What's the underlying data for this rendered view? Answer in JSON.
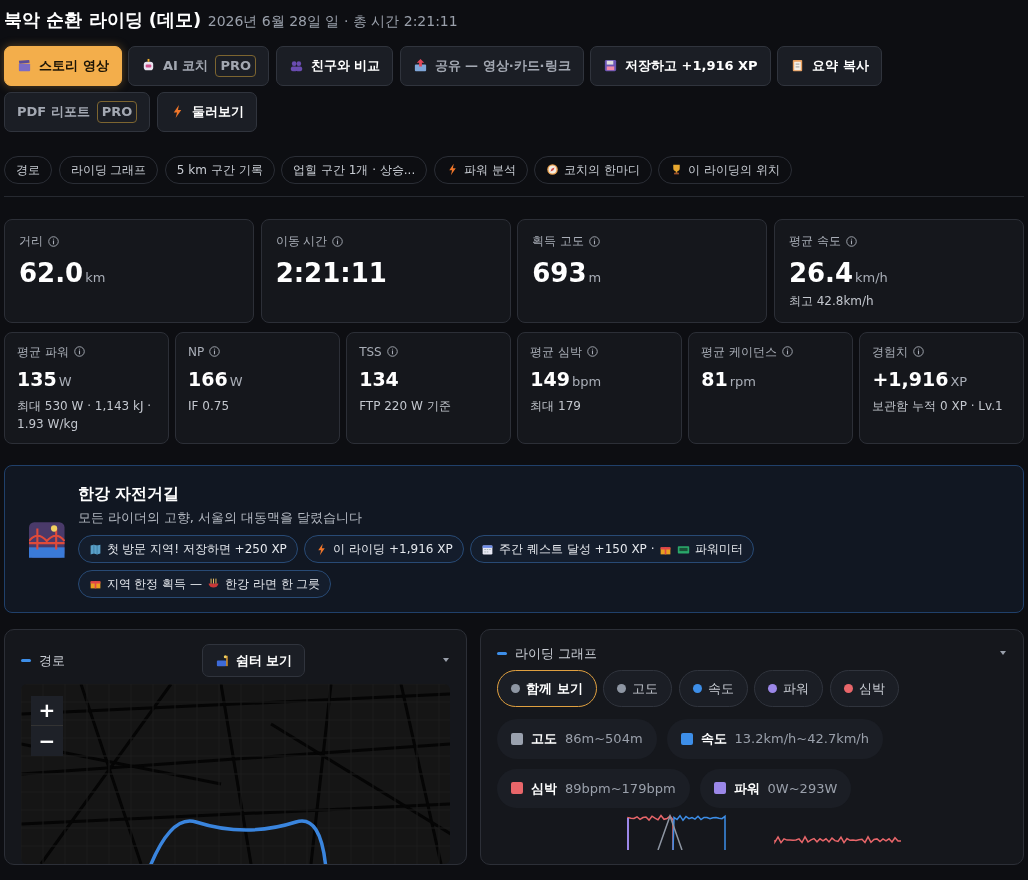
{
  "header": {
    "title": "북악 순환 라이딩 (데모)",
    "subtitle": "2026년 6월 28일 일 · 총 시간 2:21:11"
  },
  "actions": [
    {
      "label": "스토리 영상",
      "primary": true,
      "muted": false
    },
    {
      "label": "AI 코치",
      "badge": "PRO",
      "primary": false,
      "muted": true
    },
    {
      "label": "친구와 비교",
      "primary": false,
      "muted": false
    },
    {
      "label": "공유 — 영상·카드·링크",
      "primary": false,
      "muted": true
    },
    {
      "label": "저장하고 +1,916 XP",
      "primary": false,
      "muted": false
    },
    {
      "label": "요약 복사",
      "primary": false,
      "muted": false
    },
    {
      "label": "PDF 리포트",
      "badge": "PRO",
      "primary": false,
      "muted": true
    },
    {
      "label": "둘러보기",
      "primary": false,
      "muted": false
    }
  ],
  "sections": [
    "경로",
    "라이딩 그래프",
    "5 km 구간 기록",
    "업힐 구간 1개 · 상승...",
    "파워 분석",
    "코치의 한마디",
    "이 라이딩의 위치"
  ],
  "main_stats": [
    {
      "label": "거리",
      "value": "62.0",
      "unit": "km"
    },
    {
      "label": "이동 시간",
      "value": "2:21:11"
    },
    {
      "label": "획득 고도",
      "value": "693",
      "unit": "m"
    },
    {
      "label": "평균 속도",
      "value": "26.4",
      "unit": "km/h",
      "note": "최고 42.8km/h"
    }
  ],
  "detail_stats": [
    {
      "label": "평균 파워",
      "value": "135",
      "unit": "W",
      "note": "최대 530 W · 1,143 kJ · 1.93 W/kg"
    },
    {
      "label": "NP",
      "value": "166",
      "unit": "W",
      "note": "IF 0.75"
    },
    {
      "label": "TSS",
      "value": "134",
      "note": "FTP 220 W 기준"
    },
    {
      "label": "평균 심박",
      "value": "149",
      "unit": "bpm",
      "note": "최대 179"
    },
    {
      "label": "평균 케이던스",
      "value": "81",
      "unit": "rpm"
    },
    {
      "label": "경험치",
      "value": "+1,916",
      "unit": "XP",
      "note": "보관함 누적 0 XP · Lv.1"
    }
  ],
  "region": {
    "title": "한강 자전거길",
    "description": "모든 라이더의 고향, 서울의 대동맥을 달렸습니다",
    "tags": [
      {
        "parts": [
          "첫 방문 지역! 저장하면 +250 XP"
        ]
      },
      {
        "parts": [
          "이 라이딩 +1,916 XP"
        ]
      },
      {
        "parts": [
          "주간 퀘스트 달성 +150 XP ·",
          "파워미터"
        ]
      },
      {
        "parts": [
          "지역 한정 획득 —",
          "한강 라면 한 그릇"
        ]
      }
    ]
  },
  "route_panel": {
    "title": "경로",
    "shelter_button": "쉼터 보기",
    "zoom_in": "+",
    "zoom_out": "−"
  },
  "graph_panel": {
    "title": "라이딩 그래프",
    "filters": [
      {
        "label": "함께 보기",
        "color": "#8e96a3",
        "selected": true
      },
      {
        "label": "고도",
        "color": "#8e96a3",
        "selected": false
      },
      {
        "label": "속도",
        "color": "#3d8ee8",
        "selected": false
      },
      {
        "label": "파워",
        "color": "#9b87e8",
        "selected": false
      },
      {
        "label": "심박",
        "color": "#e8666a",
        "selected": false
      }
    ],
    "legend": [
      {
        "name": "고도",
        "range": "86m~504m",
        "color": "#9aa1ae"
      },
      {
        "name": "속도",
        "range": "13.2km/h~42.7km/h",
        "color": "#3d8ee8"
      },
      {
        "name": "심박",
        "range": "89bpm~179bpm",
        "color": "#e8666a"
      },
      {
        "name": "파워",
        "range": "0W~293W",
        "color": "#9b87e8"
      }
    ]
  }
}
